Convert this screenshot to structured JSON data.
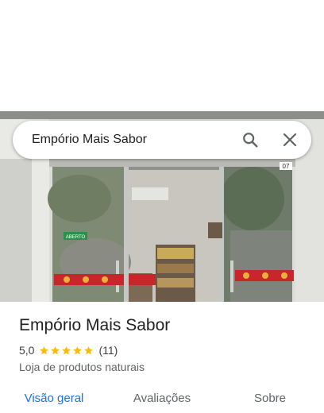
{
  "search": {
    "query": "Empório Mais Sabor"
  },
  "photo": {
    "storefront_number": "07",
    "door_sign": "ABERTO"
  },
  "place": {
    "name": "Empório Mais Sabor",
    "rating": "5,0",
    "stars": 5,
    "reviews_count": "(11)",
    "category": "Loja de produtos naturais"
  },
  "tabs": [
    {
      "label": "Visão geral",
      "active": true
    },
    {
      "label": "Avaliações",
      "active": false
    },
    {
      "label": "Sobre",
      "active": false
    }
  ],
  "colors": {
    "accent": "#1a73e8",
    "star": "#fbbc04",
    "stripe_red": "#c8262b"
  },
  "icons": {
    "search": "search-icon",
    "close": "close-icon",
    "star": "star-icon"
  }
}
